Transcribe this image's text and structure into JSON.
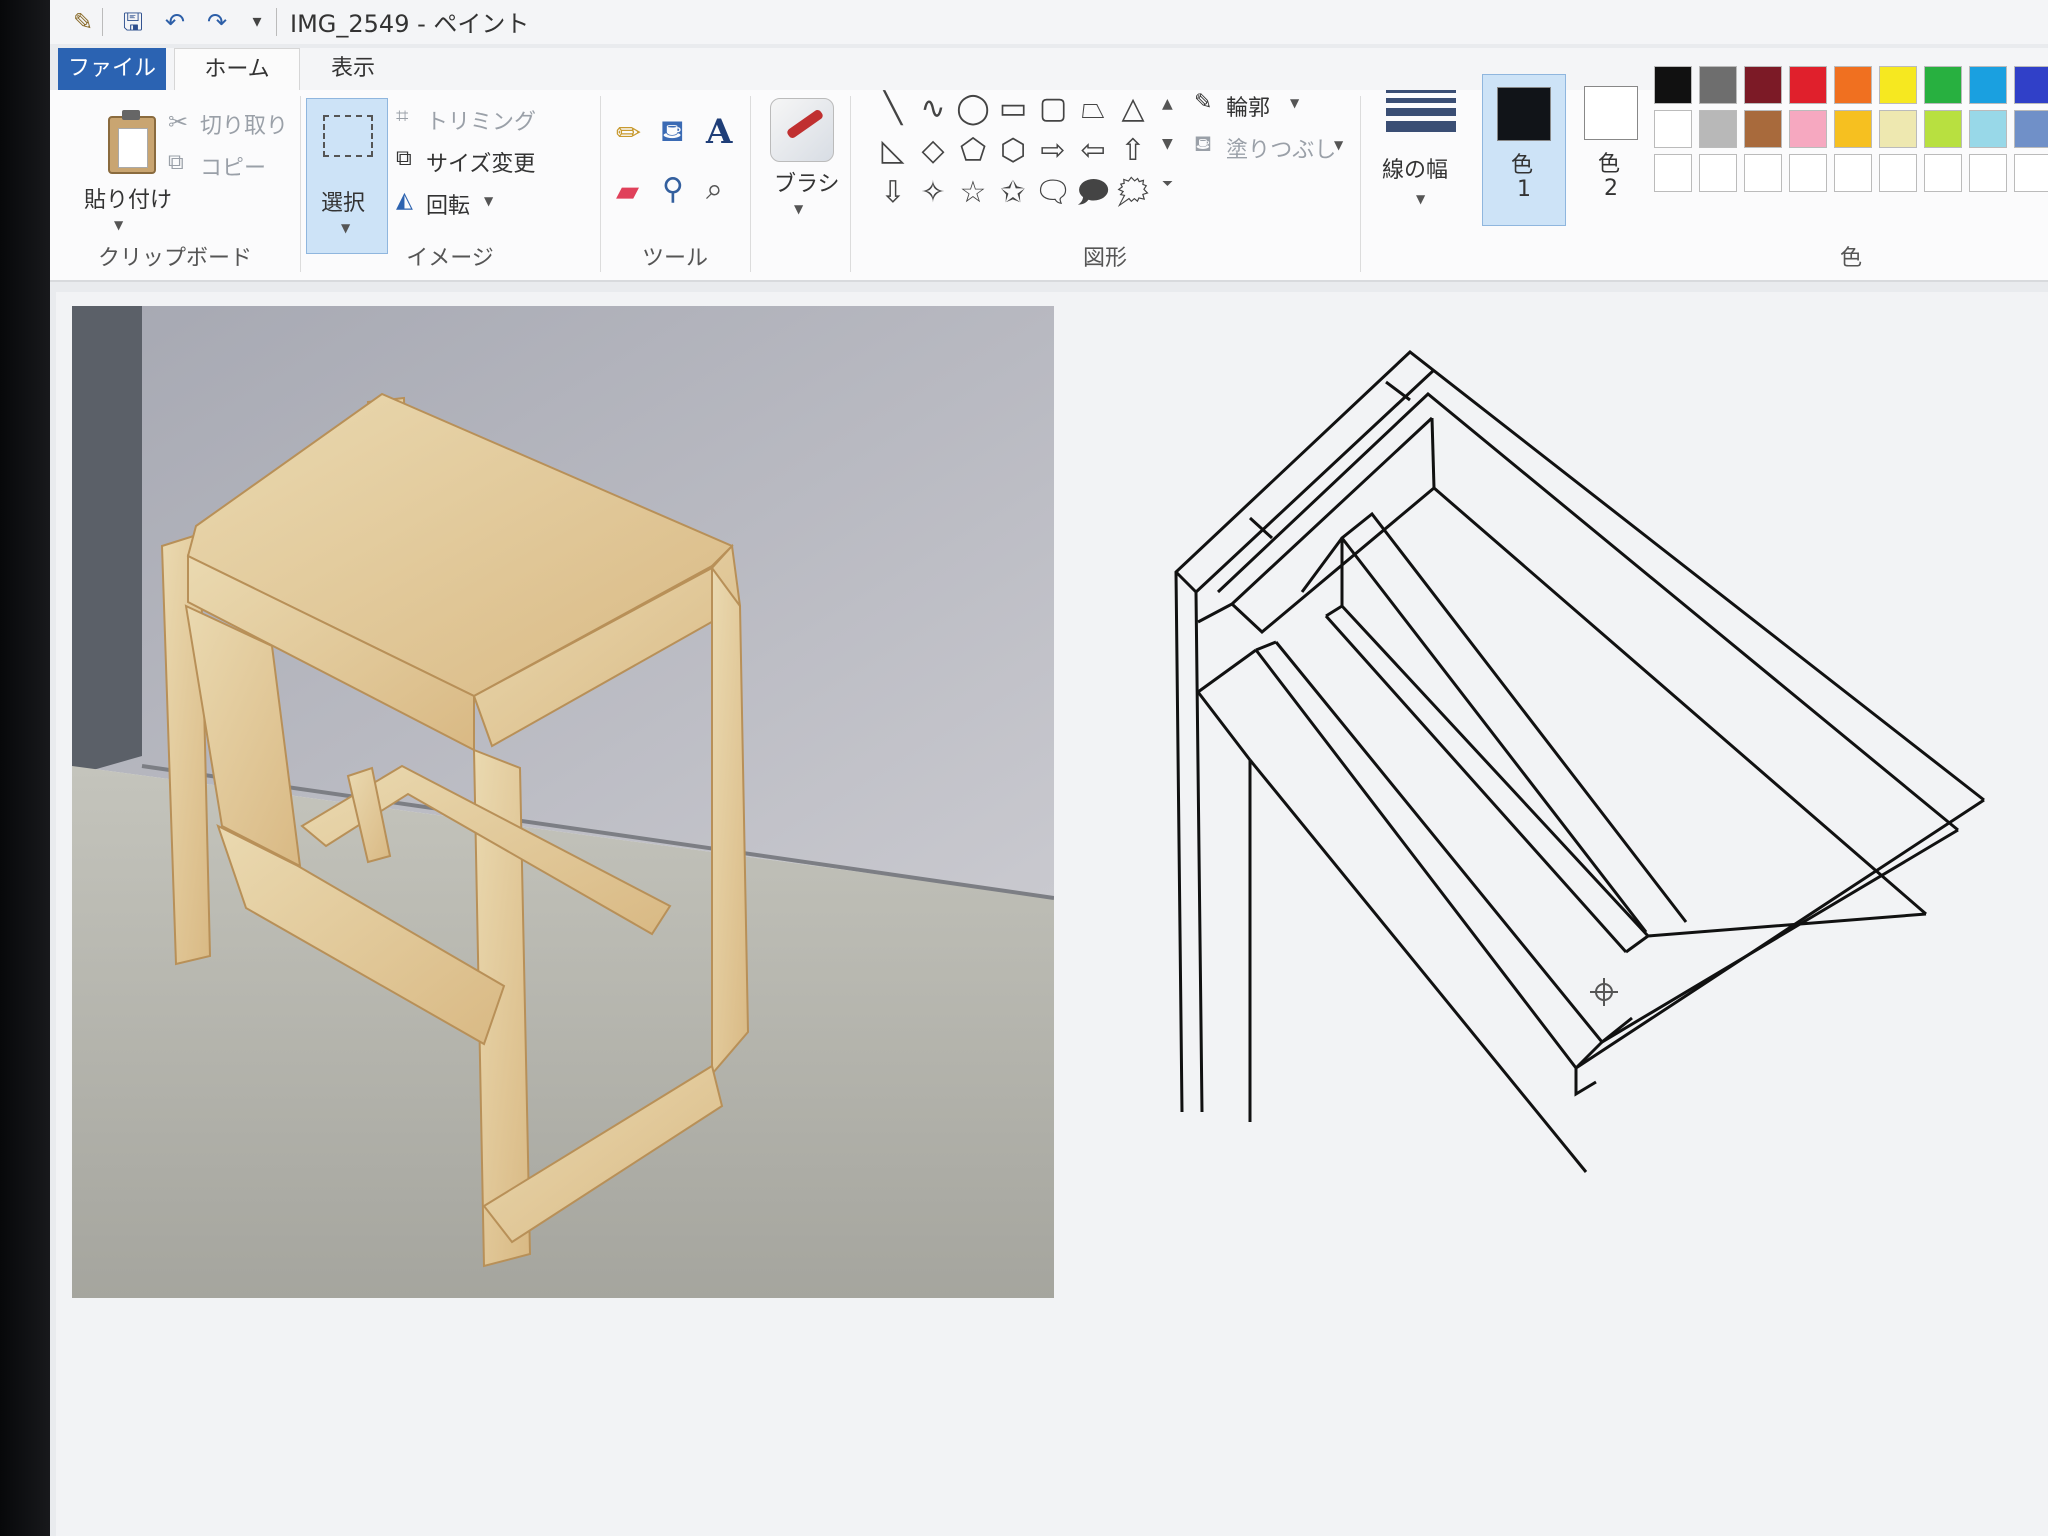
{
  "window": {
    "title": "IMG_2549 - ペイント"
  },
  "quick_access": {
    "customize_glyph": "▾"
  },
  "tabs": [
    {
      "label": "ファイル",
      "active": false
    },
    {
      "label": "ホーム",
      "active": true
    },
    {
      "label": "表示",
      "active": false
    }
  ],
  "ribbon": {
    "clipboard": {
      "paste": "貼り付け",
      "cut": "切り取り",
      "copy": "コピー",
      "group": "クリップボード"
    },
    "image": {
      "select": "選択",
      "crop": "トリミング",
      "resize": "サイズ変更",
      "rotate": "回転",
      "group": "イメージ"
    },
    "tools": {
      "group": "ツール",
      "text_glyph": "A"
    },
    "brushes": {
      "label": "ブラシ"
    },
    "shapes": {
      "outline": "輪郭",
      "fill": "塗りつぶし",
      "group": "図形",
      "glyphs": [
        "╲",
        "∿",
        "◯",
        "▭",
        "▢",
        "⏢",
        "△",
        "◺",
        "◇",
        "⬠",
        "⬡",
        "⇨",
        "⇦",
        "⇧",
        "⇩",
        "✧",
        "☆",
        "✩",
        "🗨",
        "🗩",
        "🗯"
      ]
    },
    "size": {
      "label": "線の幅"
    },
    "colors": {
      "color1_label": "色",
      "color1_num": "1",
      "color2_label": "色",
      "color2_num": "2",
      "color1_value": "#111418",
      "color2_value": "#ffffff",
      "group": "色",
      "palette_row1": [
        "#111111",
        "#6e6e6e",
        "#7c1a26",
        "#e0202c",
        "#f07020",
        "#f6e820",
        "#28b040",
        "#1aa0e0",
        "#3040c8",
        "#a040b0"
      ],
      "palette_row2": [
        "#ffffff",
        "#b8b8b8",
        "#a86a3c",
        "#f6a8c0",
        "#f6c020",
        "#eee8b0",
        "#b8e040",
        "#98d8e8",
        "#7090c8",
        "#c8b8e0"
      ],
      "palette_row3": [
        "#ffffff",
        "#ffffff",
        "#ffffff",
        "#ffffff",
        "#ffffff",
        "#ffffff",
        "#ffffff",
        "#ffffff",
        "#ffffff",
        "#ffffff"
      ]
    }
  }
}
